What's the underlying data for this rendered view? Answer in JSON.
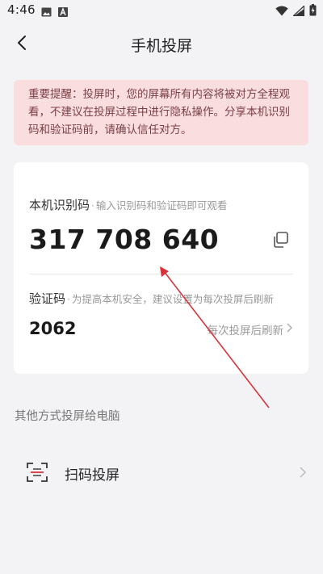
{
  "status_bar": {
    "time": "4:46",
    "icons": [
      "image-icon",
      "a-box-icon",
      "wifi-icon",
      "signal-icon",
      "battery-charging-icon"
    ]
  },
  "header": {
    "title": "手机投屏",
    "back_icon": "back-chevron-icon"
  },
  "notice": {
    "text": "重要提醒：投屏时，您的屏幕所有内容将被对方全程观看，不建议在投屏过程中进行隐私操作。分享本机识别码和验证码前，请确认信任对方。"
  },
  "card": {
    "device_code_label": "本机识别码",
    "separator": "·",
    "device_code_hint": "输入识别码和验证码即可观看",
    "device_code": "317 708 640",
    "copy_icon": "copy-icon",
    "verify_label": "验证码",
    "verify_hint": "为提高本机安全，建议设置为每次投屏后刷新",
    "verify_code": "2062",
    "refresh_label": "每次投屏后刷新"
  },
  "other": {
    "section_title": "其他方式投屏给电脑",
    "scan_label": "扫码投屏",
    "scan_icon": "scan-icon"
  },
  "colors": {
    "background": "#f3f3f5",
    "notice_bg": "#f9dddf",
    "notice_text": "#7a3f45",
    "card_bg": "#ffffff",
    "annotation_arrow": "#d8333b"
  }
}
